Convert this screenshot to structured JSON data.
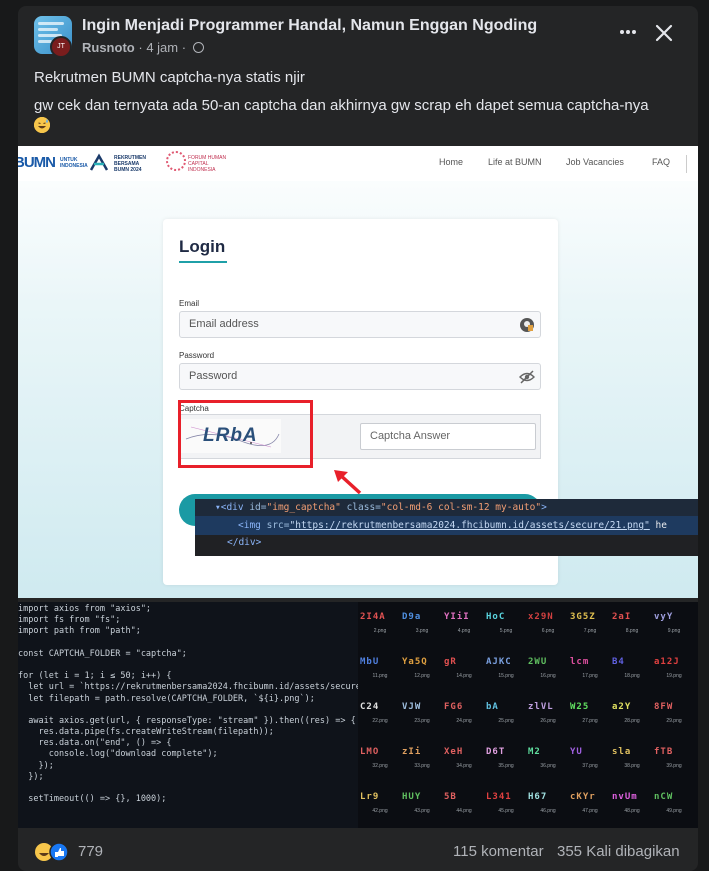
{
  "post": {
    "group_name": "Ingin Menjadi Programmer Handal, Namun Enggan Ngoding",
    "author": "Rusnoto",
    "time": "4 jam",
    "separator": "·",
    "text_line1": "Rekrutmen BUMN captcha-nya statis njir",
    "text_line2": "gw cek dan ternyata ada 50-an captcha dan akhirnya gw scrap eh dapet semua captcha-nya"
  },
  "screenshot1": {
    "logo_bumn": "BUMN",
    "logo_bumn_sub": "UNTUK INDONESIA",
    "logo_rekrutmen": "REKRUTMEN BERSAMA BUMN 2024",
    "logo_fhci": "FORUM HUMAN CAPITAL INDONESIA",
    "nav": [
      "Home",
      "Life at BUMN",
      "Job Vacancies",
      "FAQ"
    ],
    "login_title": "Login",
    "email_label": "Email",
    "email_placeholder": "Email address",
    "password_label": "Password",
    "password_placeholder": "Password",
    "captcha_label": "Captcha",
    "captcha_text": "LRbA",
    "captcha_answer_placeholder": "Captcha Answer",
    "devtools": {
      "line1_tag_open": "▾<div ",
      "line1_attr1": "id=",
      "line1_val1": "\"img_captcha\"",
      "line1_attr2": " class=",
      "line1_val2": "\"col-md-6 col-sm-12 my-auto\"",
      "line1_close": ">",
      "line2_tag_open": "<img ",
      "line2_attr": "src=",
      "line2_link": "\"https://rekrutmenbersama2024.fhcibumn.id/assets/secure/21.png\"",
      "line2_rest": " he",
      "line3": "</div>"
    }
  },
  "screenshot2": {
    "code_lines": [
      "import axios from \"axios\";",
      "import fs from \"fs\";",
      "import path from \"path\";",
      "",
      "const CAPTCHA_FOLDER = \"captcha\";",
      "",
      "for (let i = 1; i ≤ 50; i++) {",
      "  let url = `https://rekrutmenbersama2024.fhcibumn.id/assets/secure/${i",
      "  let filepath = path.resolve(CAPTCHA_FOLDER, `${i}.png`);",
      "",
      "  await axios.get(url, { responseType: \"stream\" }).then((res) => {",
      "    res.data.pipe(fs.createWriteStream(filepath));",
      "    res.data.on(\"end\", () => {",
      "      console.log(\"download complete\");",
      "    });",
      "  });",
      "",
      "  setTimeout(() => {}, 1000);"
    ],
    "captchas": [
      {
        "text": "2I4A",
        "file": "2.png",
        "color": "#e05252"
      },
      {
        "text": "D9a",
        "file": "3.png",
        "color": "#4f8fe0"
      },
      {
        "text": "YIiI",
        "file": "4.png",
        "color": "#e070c0"
      },
      {
        "text": "HoC",
        "file": "5.png",
        "color": "#5ad6e0"
      },
      {
        "text": "x29N",
        "file": "6.png",
        "color": "#d04040"
      },
      {
        "text": "3G5Z",
        "file": "7.png",
        "color": "#e0c050"
      },
      {
        "text": "2aI",
        "file": "8.png",
        "color": "#e05050"
      },
      {
        "text": "vyY",
        "file": "9.png",
        "color": "#a0a0e0"
      },
      {
        "text": "MbU",
        "file": "11.png",
        "color": "#5080e0"
      },
      {
        "text": "Ya5Q",
        "file": "12.png",
        "color": "#e0a040"
      },
      {
        "text": "gR",
        "file": "14.png",
        "color": "#e05050"
      },
      {
        "text": "AJKC",
        "file": "15.png",
        "color": "#7aa0e0"
      },
      {
        "text": "2WU",
        "file": "16.png",
        "color": "#60c060"
      },
      {
        "text": "lcm",
        "file": "17.png",
        "color": "#e050a0"
      },
      {
        "text": "B4",
        "file": "18.png",
        "color": "#6060e0"
      },
      {
        "text": "a12J",
        "file": "19.png",
        "color": "#e04040"
      },
      {
        "text": "C24",
        "file": "22.png",
        "color": "#e0e0e0"
      },
      {
        "text": "VJW",
        "file": "23.png",
        "color": "#a0c0e0"
      },
      {
        "text": "FG6",
        "file": "24.png",
        "color": "#e06060"
      },
      {
        "text": "bA",
        "file": "25.png",
        "color": "#60c0e0"
      },
      {
        "text": "zlVL",
        "file": "26.png",
        "color": "#c0a0e0"
      },
      {
        "text": "W25",
        "file": "27.png",
        "color": "#60e060"
      },
      {
        "text": "a2Y",
        "file": "28.png",
        "color": "#e0e060"
      },
      {
        "text": "8FW",
        "file": "29.png",
        "color": "#e06060"
      },
      {
        "text": "LMO",
        "file": "32.png",
        "color": "#e06060"
      },
      {
        "text": "zIi",
        "file": "33.png",
        "color": "#e0a060"
      },
      {
        "text": "XeH",
        "file": "34.png",
        "color": "#e06060"
      },
      {
        "text": "D6T",
        "file": "35.png",
        "color": "#e0a0e0"
      },
      {
        "text": "M2",
        "file": "36.png",
        "color": "#60e0a0"
      },
      {
        "text": "YU",
        "file": "37.png",
        "color": "#a060e0"
      },
      {
        "text": "sla",
        "file": "38.png",
        "color": "#e0c060"
      },
      {
        "text": "fTB",
        "file": "39.png",
        "color": "#e06060"
      },
      {
        "text": "Lr9",
        "file": "42.png",
        "color": "#e0c060"
      },
      {
        "text": "HUY",
        "file": "43.png",
        "color": "#60c060"
      },
      {
        "text": "5B",
        "file": "44.png",
        "color": "#e06060"
      },
      {
        "text": "L341",
        "file": "45.png",
        "color": "#e04040"
      },
      {
        "text": "H67",
        "file": "46.png",
        "color": "#a0e0e0"
      },
      {
        "text": "cKYr",
        "file": "47.png",
        "color": "#e0a060"
      },
      {
        "text": "nvUm",
        "file": "48.png",
        "color": "#e060e0"
      },
      {
        "text": "nCW",
        "file": "49.png",
        "color": "#60c060"
      }
    ]
  },
  "footer": {
    "reaction_count": "779",
    "comments": "115 komentar",
    "shares": "355 Kali dibagikan"
  },
  "colors": {
    "background": "#18191a",
    "card": "#242526",
    "text_primary": "#e4e6eb",
    "text_secondary": "#b0b3b8",
    "highlight_red": "#e8202a",
    "teal": "#1a9aa4"
  }
}
